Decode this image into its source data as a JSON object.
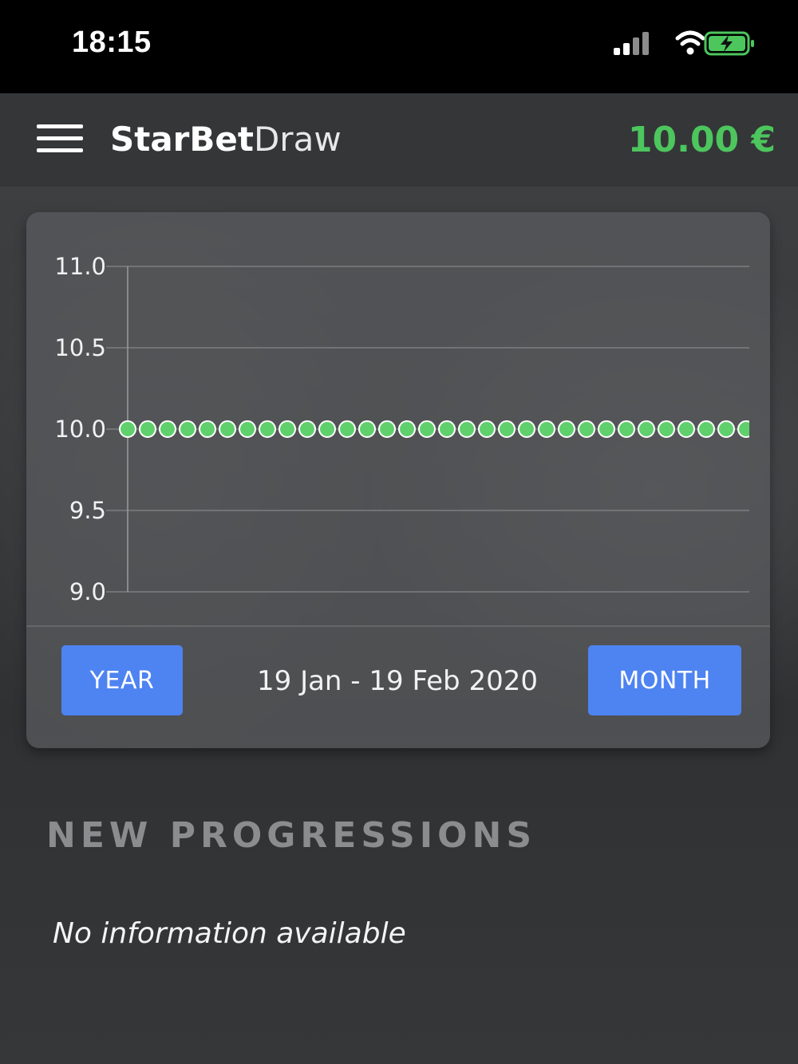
{
  "status_bar": {
    "time": "18:15",
    "icons": [
      "cellular-signal-icon",
      "wifi-icon",
      "battery-charging-icon"
    ],
    "battery_color": "#4cc65d"
  },
  "header": {
    "menu_icon": "hamburger-menu-icon",
    "brand_bold": "StarBet",
    "brand_light": "Draw",
    "balance": "10.00 €",
    "balance_color": "#4cc65d"
  },
  "chart": {
    "range_label": "19 Jan - 19 Feb 2020",
    "year_button": "YEAR",
    "month_button": "MONTH",
    "button_color": "#4e83f2"
  },
  "chart_data": {
    "type": "line",
    "ylim": [
      9.0,
      11.0
    ],
    "y_ticks": [
      "11.0",
      "10.5",
      "10.0",
      "9.5",
      "9.0"
    ],
    "y_values": [
      10.0,
      10.0,
      10.0,
      10.0,
      10.0,
      10.0,
      10.0,
      10.0,
      10.0,
      10.0,
      10.0,
      10.0,
      10.0,
      10.0,
      10.0,
      10.0,
      10.0,
      10.0,
      10.0,
      10.0,
      10.0,
      10.0,
      10.0,
      10.0,
      10.0,
      10.0,
      10.0,
      10.0,
      10.0,
      10.0,
      10.0,
      10.0
    ],
    "grid": true,
    "marker_color": "#5fd06c"
  },
  "progressions": {
    "title": "NEW PROGRESSIONS",
    "empty_message": "No information available"
  }
}
